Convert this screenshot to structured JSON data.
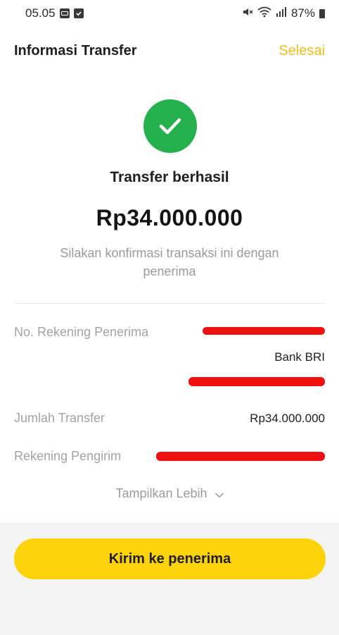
{
  "status_bar": {
    "time": "05.05",
    "battery": "87%"
  },
  "header": {
    "title": "Informasi Transfer",
    "done_label": "Selesai"
  },
  "result": {
    "title": "Transfer berhasil",
    "amount": "Rp34.000.000",
    "message": "Silakan konfirmasi transaksi ini dengan penerima"
  },
  "details": {
    "recipient_account": {
      "label": "No. Rekening Penerima",
      "bank": "Bank BRI"
    },
    "transfer_amount": {
      "label": "Jumlah Transfer",
      "value": "Rp34.000.000"
    },
    "sender_account": {
      "label": "Rekening Pengirim"
    }
  },
  "show_more_label": "Tampilkan Lebih",
  "primary_button_label": "Kirim ke penerima",
  "colors": {
    "accent_yellow": "#fcd30b",
    "link_yellow": "#f3bf14",
    "success_green": "#23b04d",
    "redaction_red": "#ee1111"
  },
  "icons": [
    "notification-app-icon",
    "checkbox-notification-icon",
    "mute-icon",
    "wifi-icon",
    "signal-icon",
    "battery-icon",
    "check-icon",
    "chevron-down-icon"
  ]
}
